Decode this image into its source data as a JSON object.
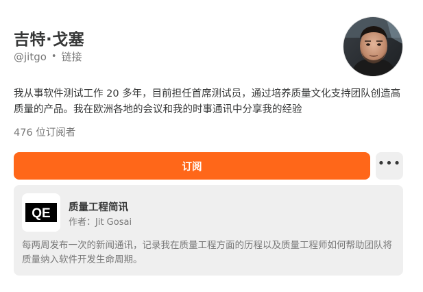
{
  "profile": {
    "name": "吉特·戈塞",
    "handle": "@jitgo",
    "separator": "•",
    "links_label": "链接",
    "bio": "我从事软件测试工作 20 多年，目前担任首席测试员，通过培养质量文化支持团队创造高质量的产品。我在欧洲各地的会议和我的时事通讯中分享我的经验",
    "subscriber_count": "476 位订阅者"
  },
  "actions": {
    "subscribe_label": "订阅",
    "more_icon": "ellipsis-icon"
  },
  "publication": {
    "logo_text": "QE",
    "title": "质量工程简讯",
    "author": "作者：Jit Gosai",
    "description": "每两周发布一次的新闻通讯，记录我在质量工程方面的历程以及质量工程师如何帮助团队将质量纳入软件开发生命周期。"
  },
  "colors": {
    "accent": "#ff6719",
    "card_bg": "#efefef",
    "text_primary": "#363737",
    "text_secondary": "#777777"
  }
}
